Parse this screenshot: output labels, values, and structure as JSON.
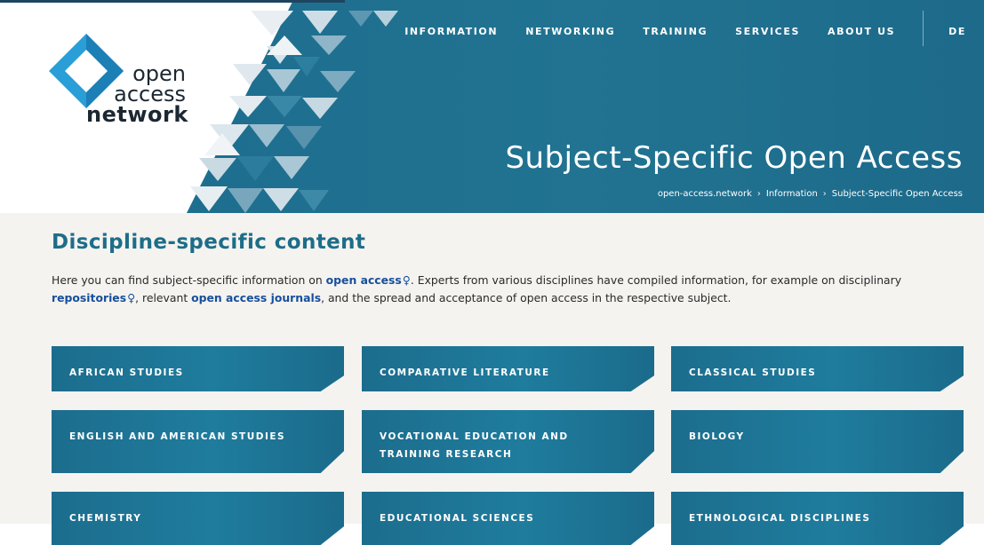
{
  "nav": {
    "items": [
      "INFORMATION",
      "NETWORKING",
      "TRAINING",
      "SERVICES",
      "ABOUT US"
    ],
    "lang": "DE"
  },
  "logo": {
    "line1": "open",
    "line2": "access",
    "line3": "network"
  },
  "hero": {
    "title": "Subject-Specific Open Access",
    "breadcrumb": [
      "open-access.network",
      "Information",
      "Subject-Specific Open Access"
    ]
  },
  "main": {
    "heading": "Discipline-specific content",
    "intro": {
      "t1": "Here you can find subject-specific information on ",
      "link1": "open access",
      "t2": ". Experts from various disciplines have compiled information, for example on disciplinary ",
      "link2": "repositories",
      "t3": ", relevant ",
      "link3": "open access journals",
      "t4": ", and the spread and acceptance of open access in the respective subject."
    },
    "cards": [
      "AFRICAN STUDIES",
      "COMPARATIVE LITERATURE",
      "CLASSICAL STUDIES",
      "ENGLISH AND AMERICAN STUDIES",
      "VOCATIONAL EDUCATION AND TRAINING RESEARCH",
      "BIOLOGY",
      "CHEMISTRY",
      "EDUCATIONAL SCIENCES",
      "ETHNOLOGICAL DISCIPLINES"
    ]
  },
  "colors": {
    "hero": "#1e6f90",
    "accent": "#1d6d88",
    "link": "#174f9c",
    "card": "#1f7595",
    "background": "#f5f3f0"
  },
  "icons": [
    "logo-diamond-icon",
    "lightbulb-icon",
    "chevron-right-icon"
  ]
}
